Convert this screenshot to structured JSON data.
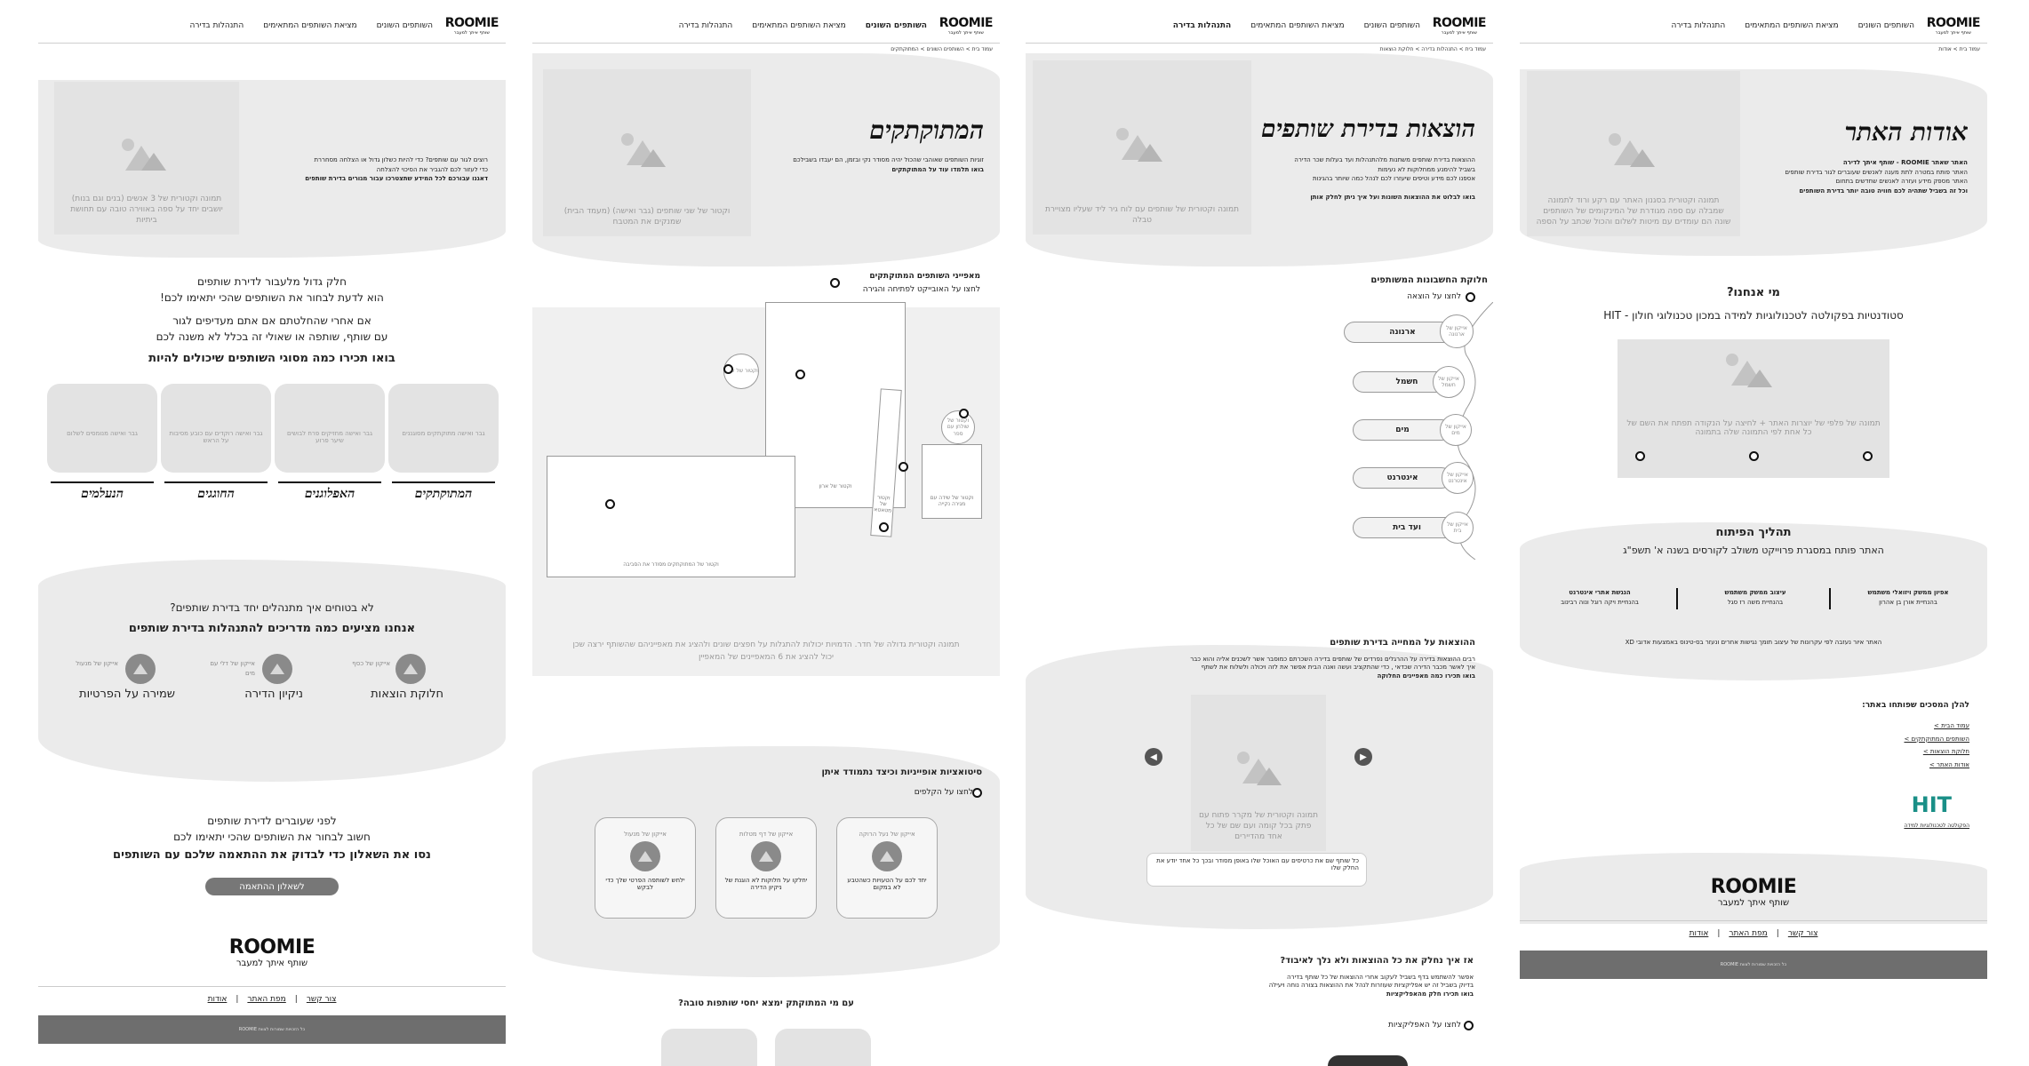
{
  "brand": {
    "logo": "ROOMIE",
    "tagline": "שותף איתך למעבר"
  },
  "nav": {
    "about": "אודות",
    "partners": "השותפים השונים",
    "match": "מציאת השותפים המתאימים",
    "manage": "התנהלות בדירה"
  },
  "footer": {
    "about": "אודות",
    "sitemap": "מפת האתר",
    "contact": "צור קשר",
    "copyright": "כל הזכויות שמורות לצוות ROOMIE"
  },
  "p1": {
    "hero_lines": [
      "רוצים לגור עם שותפים? כדי להיות כשלון גדול או הצלחה מסחררת",
      "כדי לעזור לכם להגביר את הסיכוי להצלחה",
      "דאגנו עבורכם לכל המידע שתצטרכו עבור מגורים בדירת שותפים"
    ],
    "hero_img": "תמונה וקטורית של 3 אנשים (בנים וגם בנות) יושבים יחד על ספה באווירה טובה עם תחושת ביתיות",
    "intro1": "חלק גדול מלעבור לדירת שותפים",
    "intro2": "הוא לדעת לבחור את השותפים שהכי יתאימו לכם!",
    "intro3": "אם אחרי שהחלטתם אם אתם מעדיפים לגור",
    "intro4": "עם שותף, שותפה או שאולי זה בכלל לא משנה לכם",
    "types_title": "בואו תכירו כמה מסוגי השותפים שיכולים להיות",
    "types": [
      {
        "img": "גבר ואישה מתוקתקים מסוגננים",
        "label": "המתוקתקים"
      },
      {
        "img": "גבר ואישה מחזיקים פרח לבושים שיער פרוע",
        "label": "האפלוגנים"
      },
      {
        "img": "גבר ואישה רוקדים עם כובע מסיבות על הראש",
        "label": "החוגגים"
      },
      {
        "img": "גבר ואישה מנומסים לשלום",
        "label": "הנעלמים"
      }
    ],
    "manage_q": "לא בטוחים איך מתנהלים יחד בדירת שותפים?",
    "manage_t": "אנחנו מציעים כמה מדריכים להתנהלות בדירת שותפים",
    "guides": [
      {
        "icon": "אייקון של כסף",
        "label": "חלוקת הוצאות"
      },
      {
        "icon": "אייקון של דלי עם מים",
        "label": "ניקיון הדירה"
      },
      {
        "icon": "אייקון של מנעול",
        "label": "שמירה על הפרטיות"
      }
    ],
    "q1": "לפני שעוברים לדירת שותפים",
    "q2": "חשוב לבחור את השותפים שהכי יתאימו לכם",
    "q3": "נסו את השאלון כדי לבדוק את ההתאמה שלכם עם השותפים",
    "q_btn": "לשאלון ההתאמה"
  },
  "p2": {
    "crumb": "עמוד בית > השותפים השונים > המתוקתקים",
    "title": "המתוקתקים",
    "lines": [
      "זוגיות השותפים שאוהבי שהכול יהיה מסודר נקי ובזמן, הם יעבדו בשבילכם",
      "בואו תלמדו עוד על המתוקתקים"
    ],
    "hero_img": "וקטור של שני שותפים (גבר ואישה) (מעמד הבית) שמנקים את המטבח",
    "traits_title": "מאפייני השותפים המתוקתקים",
    "traits_hint": "לחצו על האובייקט לפתיחה והגירה",
    "room_caption": "תמונה וקטורית גדולה של חדר. הדמויות יכולות להתגלות על חפצים שונים ולהציג את מאפייניהם שהשותף ירצה שכן יכול להציג את 6 המאפיינים של המאפיין",
    "objects": [
      "וקטור של שעון",
      "וקטור של ארון",
      "וקטור של מטאטא",
      "וקטור של שולחן עם ספר",
      "וקטור של שידה עם מגירה נקייה",
      "וקטור של המתוקתקים מסודר את הסביבה"
    ],
    "situations_title": "סיטואציות אופייניות וכיצד נתמודד איתן",
    "situations_hint": "לחצו על הקלפים",
    "cards": [
      {
        "icon": "אייקון של נעל הרוקה",
        "text": "יחד לכם על הטעויות כשהטבע לא במקום"
      },
      {
        "icon": "אייקון של דף מטלות",
        "text": "יחלקו על חלוקות לא הוגנת של ניקיון הדירה"
      },
      {
        "icon": "אייקון של מנעול",
        "text": "ילחש לשותפה הפרטי שלך כדי לבקש"
      }
    ],
    "match_title": "עם מי המתוקתק ימצא יחסי שותפות טובה?"
  },
  "p3": {
    "crumb": "עמוד בית > התנהלות בדירה > חלוקת הוצאות",
    "title": "הוצאות בדירת שותפים",
    "lines": [
      "ההוצאות בדירת שותפים משתנות מלהתנהלות ועד בעלות שכר הדירה",
      "בשביל להימנע ממחלוקות לא נעימות",
      "אספנו לכם מידע וטיפים שיעזרו לכם לנהל כמה שיותר בהגינות"
    ],
    "bold": "בואו לבלוט את ההוצאות השונות ועל איך ניתן לחלק אותן",
    "hero_img": "תמונה וקטורית של שותפים עם לוח גיר ליד שעליו מצויירת טבלה",
    "split_title": "חלוקת החשבונות המשותפים",
    "split_hint": "לחצו על הוצאה",
    "bills": [
      {
        "icon": "אייקון של ארנונה",
        "label": "ארנונה"
      },
      {
        "icon": "אייקון של חשמל",
        "label": "חשמל"
      },
      {
        "icon": "אייקון של מים",
        "label": "מים"
      },
      {
        "icon": "אייקון של אינטרנט",
        "label": "אינטרנט"
      },
      {
        "icon": "אייקון של בית",
        "label": "ועד בית"
      }
    ],
    "rent_title": "ההוצאות על המחייה בדירת שותפים",
    "rent_lines": [
      "רבים ההוצאות בדירה על ההרגלים נפרדים של שותפים בדירה השכרתם כמוסבר אשר לשכנים אליה והוא כבר",
      "איך לאשר מכבר הדירה שכדאי , כדי שהתקציב ועשה ואנה הבית אפשר את לזה ויכולה ולשלוח את לשתף",
      "בואו תכירו כמה מאפיינים החלוקה"
    ],
    "carousel_img": "תמונה וקטורית של מקרר פתוח עם פתק בכל קומה ועם שם של כל אחד מהדיירים",
    "bubble": "כל שותף שם את כרטיסים עם האוכל שלו באופן מסודר ובכך כל אחד יודע את החלק שלו",
    "app_title": "אז איך נחלק את כל ההוצאות ולא נלך לאיבוד?",
    "app_lines": [
      "אפשר להשתמש בדף בשביל לעקוב אחרי ההוצאות של כל שותף בדירה",
      "בדיוק בשביל זה יש אפליקציות שעוזרות לנהל את ההוצאות בצורה נוחה ויעילה",
      "בואו תכירו חלק מהאפליקציות"
    ],
    "app_hint": "לחצו על האפליקציות"
  },
  "p4": {
    "crumb": "עמוד בית > אודות",
    "title": "אודות האתר",
    "lines": [
      "האתר שאתר ROOMIE - שותף איתך לדירה",
      "האתר פותח במטרה לתת מענה לאנשים שעוברים לגור בדירת שותפים",
      "האתר מספק מידע ועזרה לאנשים שחדשים בתחום",
      "וכל זה בשביל שתהיה לכם חוויה טובה יותר בדירת השותפים"
    ],
    "hero_img": "תמונה וקטורית בסגנון האתר עם רקע ורוד לתמונה שמבלה עם ספה מגודרת של המינקומים של השותפים שונה הם עומדים עם מיטות לשלום והכול שכתב על הספה",
    "who_title": "מי אנחנו?",
    "who_sub": "סטודנטיות בפקולטה לטכנולוגיות למידה במכון טכנולוגי חולון - HIT",
    "team_img": "תמונה של פלפי של יוצרות האתר + לחיצה על הנקודה תפתח את השם של כל אחת לפי התמונה שלה בתמונה",
    "process_title": "תהליך הפיתוח",
    "process_sub": "האתר פותח במסגרת פרוייקט משולב לקורסים בשנה א' תשפ\"ג",
    "courses": [
      {
        "t": "אפיון ממשק ויזואלי משתמש",
        "s": "בהנחיית אורן בן אהרון"
      },
      {
        "t": "עיצוב ממשק משתמש",
        "s": "בהנחיית משה רז סגל"
      },
      {
        "t": "הנגשת אתרי אינטרנט",
        "s": "בהנחיית ויקה רוגל ונוה רבינוב"
      }
    ],
    "icons_credit": "האתר איור נעזבה לפי עקרונות של עיצוב תומך נגישות אחרים ונעזר בס-טינוס באמצעות אדובי XD",
    "links_title": "להלן המסכים שפותחו באתר:",
    "links": [
      "עמוד הבית >",
      "השותפים המתוקתקים >",
      "חלוקת הוצאות >",
      "אודות האתר >"
    ],
    "hit_label": "הפקולטה לטכנולוגיות למידה"
  }
}
